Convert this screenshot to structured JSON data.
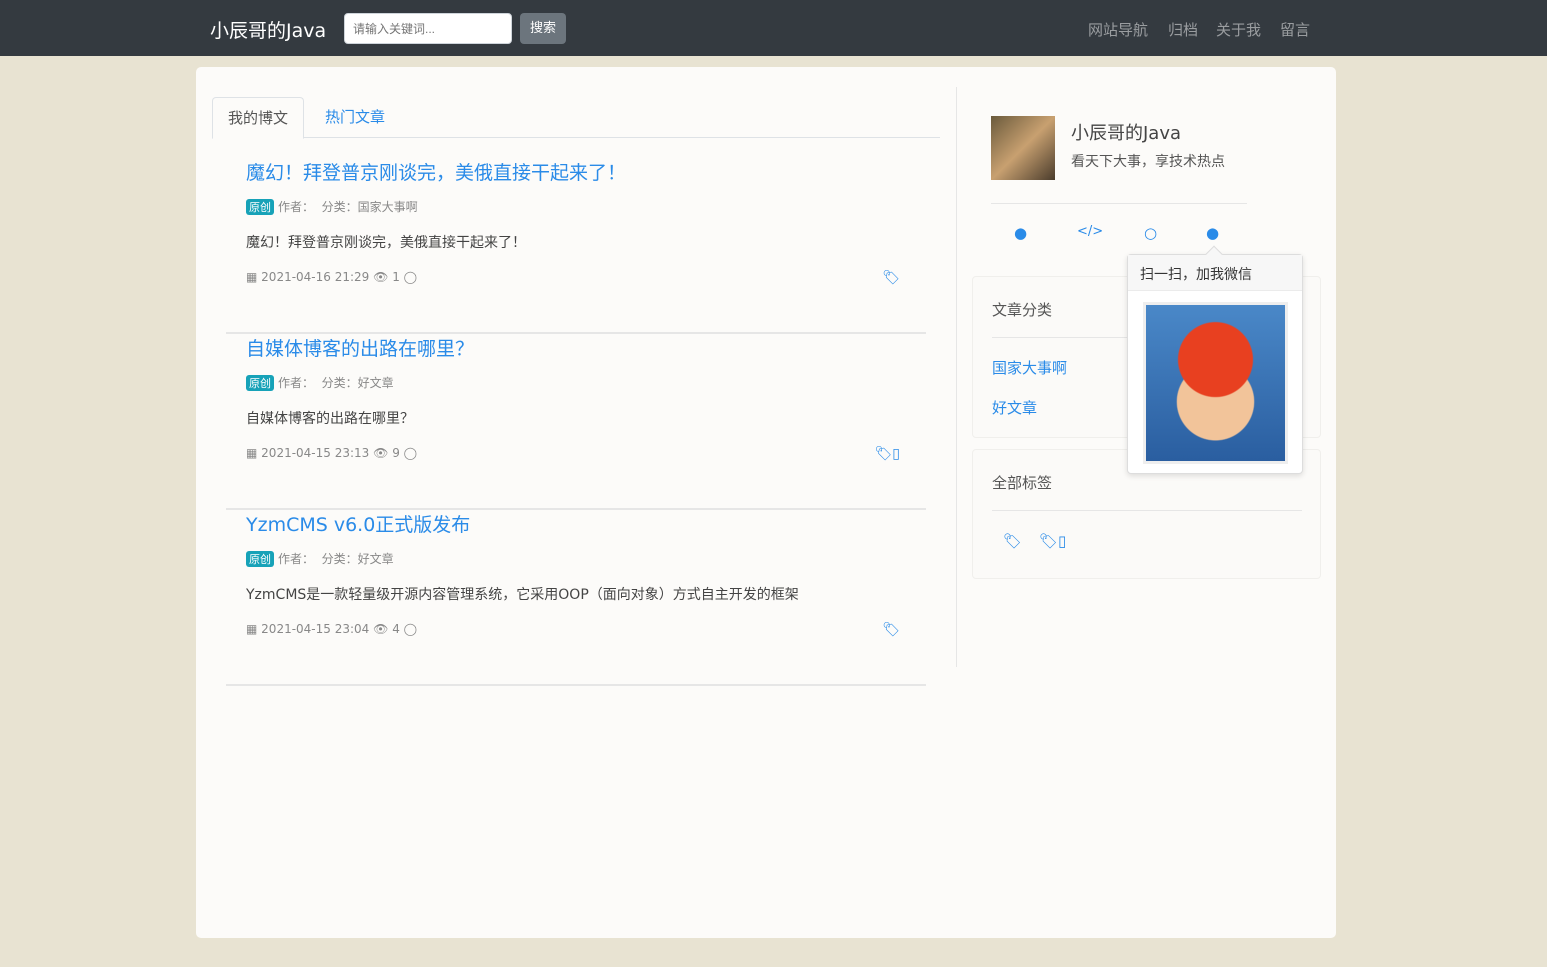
{
  "nav": {
    "brand": "小辰哥的Java",
    "search_placeholder": "请输入关键词...",
    "search_button": "搜索",
    "menu": [
      "网站导航",
      "归档",
      "关于我",
      "留言"
    ]
  },
  "tabs": [
    "我的博文",
    "热门文章"
  ],
  "posts": [
    {
      "title": "魔幻！拜登普京刚谈完，美俄直接干起来了！",
      "badge": "原创",
      "author": "作者：",
      "category": "分类：国家大事啊",
      "summary": "魔幻！拜登普京刚谈完，美俄直接干起来了！",
      "date": "2021-04-16 21:29",
      "views": "1",
      "tag": ""
    },
    {
      "title": "自媒体博客的出路在哪里？",
      "badge": "原创",
      "author": "作者：",
      "category": "分类：好文章",
      "summary": "自媒体博客的出路在哪里？",
      "date": "2021-04-15 23:13",
      "views": "9",
      "tag": "▯"
    },
    {
      "title": "YzmCMS v6.0正式版发布",
      "badge": "原创",
      "author": "作者：",
      "category": "分类：好文章",
      "summary": "YzmCMS是一款轻量级开源内容管理系统，它采用OOP（面向对象）方式自主开发的框架",
      "date": "2021-04-15 23:04",
      "views": "4",
      "tag": ""
    }
  ],
  "profile": {
    "name": "小辰哥的Java",
    "desc": "看天下大事，享技术热点"
  },
  "popover": {
    "title": "扫一扫，加我微信"
  },
  "categories": {
    "title": "文章分类",
    "items": [
      "国家大事啊",
      "好文章"
    ]
  },
  "tags": {
    "title": "全部标签",
    "items": [
      "",
      "▯"
    ]
  }
}
